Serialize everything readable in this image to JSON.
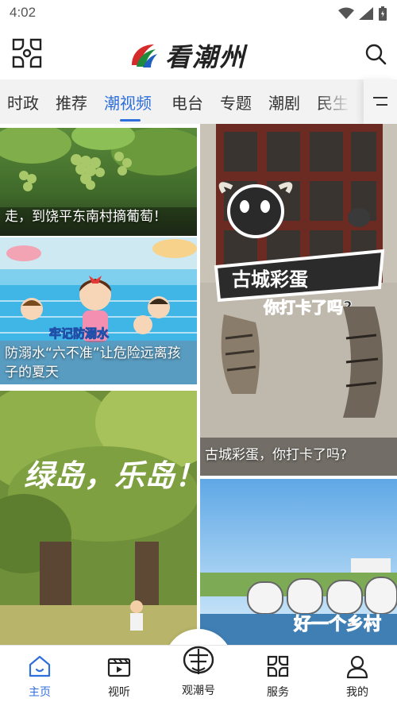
{
  "status_bar": {
    "time": "4:02"
  },
  "header": {
    "logo_text": "看潮州"
  },
  "tabs": [
    {
      "label": "时政"
    },
    {
      "label": "推荐"
    },
    {
      "label": "潮视频",
      "active": true
    },
    {
      "label": "电台"
    },
    {
      "label": "专题"
    },
    {
      "label": "潮剧"
    },
    {
      "label": "民生"
    }
  ],
  "feed": [
    {
      "title": "走，到饶平东南村摘葡萄！"
    },
    {
      "title": "防溺水“六不准”让危险远离孩子的夏天",
      "overlay_text": "牢记防溺水"
    },
    {
      "title": "",
      "overlay_text": "绿岛，乐岛！"
    },
    {
      "title": "古城彩蛋，你打卡了吗?",
      "overlay_text_1": "古城彩蛋",
      "overlay_text_2": "你打卡了吗?"
    },
    {
      "title": "",
      "overlay_text": "好一个乡村"
    }
  ],
  "bottom_nav": [
    {
      "label": "主页",
      "icon": "home-icon",
      "active": true
    },
    {
      "label": "视听",
      "icon": "video-icon"
    },
    {
      "label": "观潮号",
      "icon": "guanchao-icon"
    },
    {
      "label": "服务",
      "icon": "services-icon"
    },
    {
      "label": "我的",
      "icon": "profile-icon"
    }
  ],
  "colors": {
    "accent": "#2f6fdb",
    "tab_bar_bg": "#f2f2f2"
  }
}
